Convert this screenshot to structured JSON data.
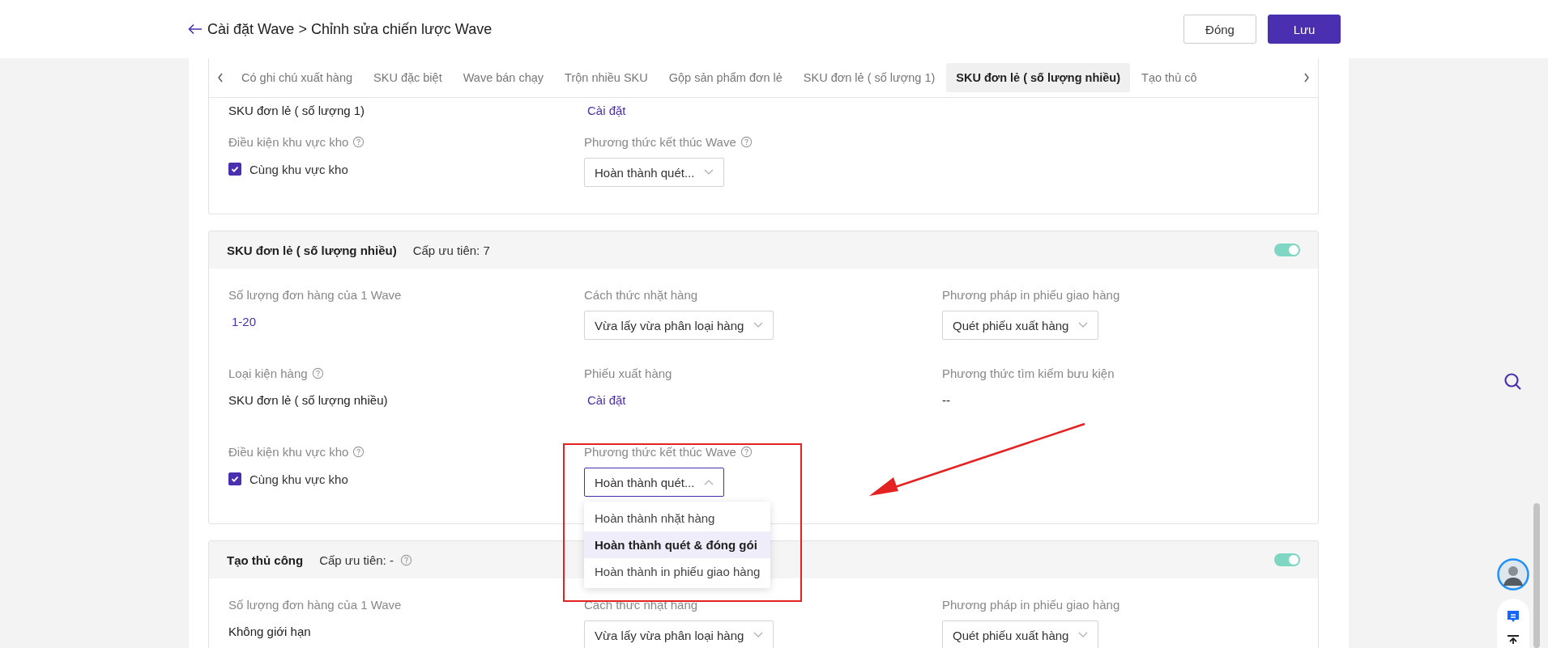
{
  "header": {
    "title": "Cài đặt Wave > Chỉnh sửa chiến lược Wave",
    "buttons": [
      {
        "label": "Đóng",
        "kind": "secondary"
      },
      {
        "label": "Lưu",
        "kind": "primary"
      }
    ]
  },
  "tabs": [
    {
      "label": "Có ghi chú xuất hàng",
      "selected": false
    },
    {
      "label": "SKU đặc biệt",
      "selected": false
    },
    {
      "label": "Wave bán chạy",
      "selected": false
    },
    {
      "label": "Trộn nhiều SKU",
      "selected": false
    },
    {
      "label": "Gộp sản phẩm đơn lẻ",
      "selected": false
    },
    {
      "label": "SKU đơn lẻ ( số lượng 1)",
      "selected": false
    },
    {
      "label": "SKU đơn lẻ ( số lượng nhiều)",
      "selected": true
    },
    {
      "label": "Tạo thủ cô",
      "selected": false
    }
  ],
  "cards": [
    {
      "rows": [
        [
          {
            "kind": "text",
            "value": "SKU đơn lẻ ( số lượng 1)"
          },
          {
            "kind": "link",
            "value": "Cài đặt"
          }
        ],
        [
          {
            "label": "Điều kiện khu vực kho",
            "help": true,
            "kind": "checkbox",
            "value": "Cùng khu vực kho",
            "checked": true
          },
          {
            "label": "Phương thức kết thúc Wave",
            "help": true,
            "kind": "select",
            "value": "Hoàn thành quét...",
            "open": false
          }
        ]
      ]
    },
    {
      "title": "SKU đơn lẻ ( số lượng nhiều)",
      "priority": "Cấp ưu tiên: 7",
      "priority_help": false,
      "enabled": true,
      "rows": [
        [
          {
            "label": "Số lượng đơn hàng của 1 Wave",
            "help": false,
            "kind": "link",
            "value": "1-20"
          },
          {
            "label": "Cách thức nhặt hàng",
            "help": false,
            "kind": "select",
            "value": "Vừa lấy vừa phân loại hàng",
            "open": false
          },
          {
            "label": "Phương pháp in phiếu giao hàng",
            "help": false,
            "kind": "select",
            "value": "Quét phiếu xuất hàng",
            "open": false
          }
        ],
        [
          {
            "label": "Loại kiện hàng",
            "help": true,
            "kind": "text",
            "value": "SKU đơn lẻ ( số lượng nhiều)"
          },
          {
            "label": "Phiếu xuất hàng",
            "help": false,
            "kind": "link",
            "value": "Cài đặt"
          },
          {
            "label": "Phương thức tìm kiếm bưu kiện",
            "help": false,
            "kind": "text",
            "value": "--"
          }
        ],
        [
          {
            "label": "Điều kiện khu vực kho",
            "help": true,
            "kind": "checkbox",
            "value": "Cùng khu vực kho",
            "checked": true
          },
          {
            "label": "Phương thức kết thúc Wave",
            "help": true,
            "kind": "select",
            "value": "Hoàn thành quét...",
            "open": true,
            "options": [
              {
                "label": "Hoàn thành nhặt hàng",
                "selected": false
              },
              {
                "label": "Hoàn thành quét & đóng gói",
                "selected": true
              },
              {
                "label": "Hoàn thành in phiếu giao hàng",
                "selected": false
              }
            ]
          }
        ]
      ]
    },
    {
      "title": "Tạo thủ công",
      "priority": "Cấp ưu tiên: -",
      "priority_help": true,
      "enabled": true,
      "rows": [
        [
          {
            "label": "Số lượng đơn hàng của 1 Wave",
            "help": false,
            "kind": "text",
            "value": "Không giới hạn"
          },
          {
            "label": "Cách thức nhặt hàng",
            "help": false,
            "kind": "select",
            "value": "Vừa lấy vừa phân loại hàng",
            "open": false
          },
          {
            "label": "Phương pháp in phiếu giao hàng",
            "help": false,
            "kind": "select",
            "value": "Quét phiếu xuất hàng",
            "open": false
          }
        ]
      ]
    }
  ]
}
